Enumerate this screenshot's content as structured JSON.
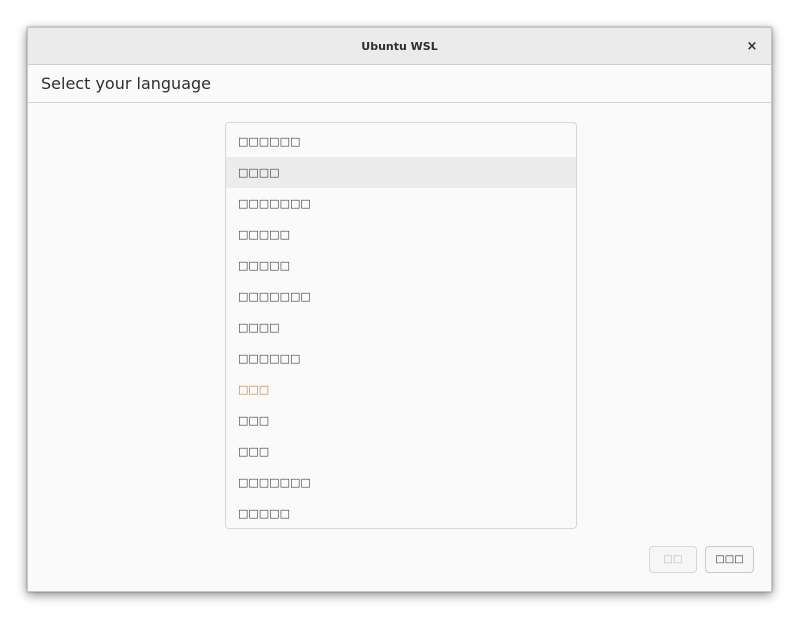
{
  "window": {
    "title": "Ubuntu WSL",
    "close_glyph": "×",
    "close_icon": "close-icon"
  },
  "header": {
    "heading": "Select your language"
  },
  "languages": {
    "selected_index": 1,
    "accent_color": "#c27e3a",
    "items": [
      "□□□□□□",
      "□□□□",
      "□□□□□□□",
      "□□□□□",
      "□□□□□",
      "□□□□□□□",
      "□□□□",
      "□□□□□□",
      "□□□",
      "□□□",
      "□□□",
      "□□□□□□□",
      "□□□□□"
    ]
  },
  "footer": {
    "back_label": "□□",
    "next_label": "□□□"
  }
}
